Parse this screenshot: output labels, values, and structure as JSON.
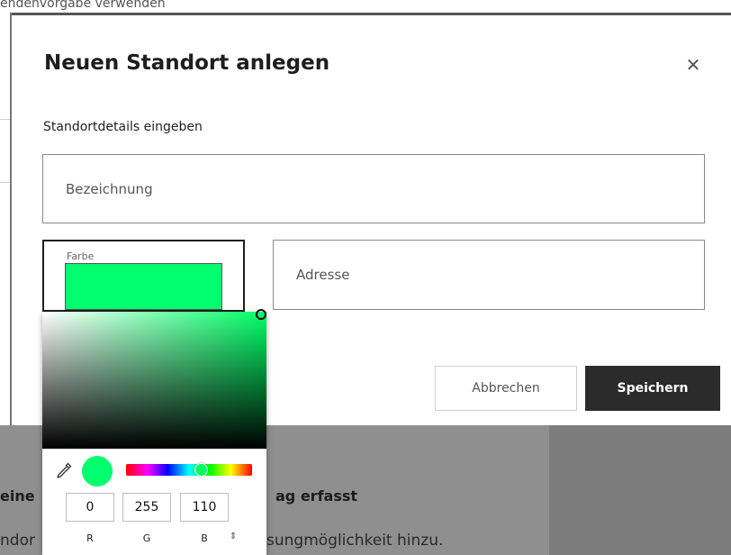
{
  "background": {
    "top_text": "endenvorgabe verwenden",
    "heading_left": "eine",
    "heading_right": "ag erfasst",
    "sub_left": "ndor",
    "sub_right": "sungmöglichkeit hinzu."
  },
  "dialog": {
    "title": "Neuen Standort anlegen",
    "close_icon": "close-icon",
    "section_label": "Standortdetails eingeben",
    "name_placeholder": "Bezeichnung",
    "color_label": "Farbe",
    "address_placeholder": "Adresse",
    "cancel_label": "Abbrechen",
    "save_label": "Speichern"
  },
  "color_picker": {
    "selected_color": "#00ff6e",
    "hue_color": "#00ff66",
    "hue_fraction": 0.59,
    "rgb": {
      "r": "0",
      "g": "255",
      "b": "110"
    },
    "labels": {
      "r": "R",
      "g": "G",
      "b": "B"
    },
    "mode_toggle_icon": "⇕",
    "eyedropper_icon": "eyedropper-icon"
  },
  "colors": {
    "overlay": "#7c7c7c",
    "primary_button": "#2b2b2b"
  }
}
